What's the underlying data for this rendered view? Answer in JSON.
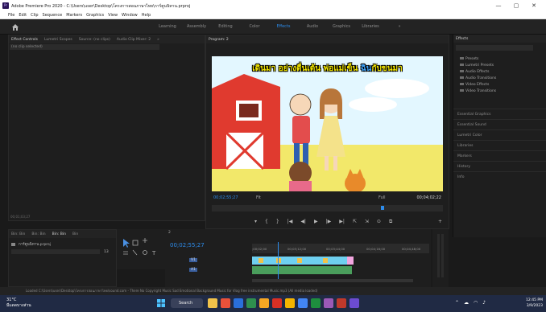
{
  "window": {
    "title": "Adobe Premiere Pro 2020 - C:\\Users\\user\\Desktop\\โครงการสอนภาษาไทย\\การ์ตูนนิทาน.prproj",
    "app_badge": "Pr",
    "controls": [
      "—",
      "▢",
      "✕"
    ]
  },
  "menu": [
    "File",
    "Edit",
    "Clip",
    "Sequence",
    "Markers",
    "Graphics",
    "View",
    "Window",
    "Help"
  ],
  "workspaces": {
    "items": [
      "Learning",
      "Assembly",
      "Editing",
      "Color",
      "Effects",
      "Audio",
      "Graphics",
      "Libraries",
      "»"
    ],
    "active_index": 4
  },
  "left_panel": {
    "tabs": [
      "Effect Controls",
      "Lumetri Scopes",
      "Source: (no clips)",
      "Audio Clip Mixer: 2",
      "»"
    ],
    "clip_selector": "(no clip selected)",
    "timecode": "00;01;03;27"
  },
  "program": {
    "title": "Program: 2",
    "subtitle_main": "เดินมา อย่างตื่นเต้น พ่อแม่เข็น ",
    "subtitle_highlight": "ฉิน",
    "subtitle_tail": "กับขนมา",
    "timecode": "00;02;55;27",
    "fit": "Fit",
    "quality": "Full",
    "duration": "00;04;02;22",
    "transport": [
      "▾",
      "{",
      "}",
      "|◀",
      "◀|",
      "▶",
      "|▶",
      "▶|",
      "⇱",
      "⇲",
      "⊙",
      "⧉"
    ],
    "add": "+"
  },
  "effects": {
    "title": "Effects",
    "tree": [
      "Presets",
      "Lumetri Presets",
      "Audio Effects",
      "Audio Transitions",
      "Video Effects",
      "Video Transitions"
    ],
    "sections": [
      "Essential Graphics",
      "Essential Sound",
      "Lumetri Color",
      "Libraries",
      "Markers",
      "History",
      "Info"
    ]
  },
  "project": {
    "tabs": [
      "Bin: Bin",
      "Bin: Bin",
      "Bin: Bin",
      "Bin"
    ],
    "file": "การ์ตูนนิทาน.prproj",
    "count": "13"
  },
  "timeline": {
    "tab": "2",
    "timecode": "00;02;55;27",
    "ruler": [
      ";00;02;00",
      "00;03;12;00",
      "00;03;44;00",
      "00;04;16;00",
      "00;04;48;00"
    ],
    "tracks": [
      "V1",
      "A1"
    ]
  },
  "status": "Loaded C:\\Users\\user\\Desktop\\โครงการสอนภาษาไทย\\sound.com - There No Copyright Music Sad Emotional Background Music for Vlog free instrumental Music.mp3 (All media loaded)",
  "taskbar": {
    "temp": "31°C",
    "weather": "มีแดดบางส่วน",
    "search": "Search",
    "time": "12:45 PM",
    "date": "3/9/2023",
    "app_colors": [
      "#f0c24a",
      "#e8513a",
      "#2a6fdb",
      "#2f8f4e",
      "#f5a623",
      "#d93025",
      "#f4b400",
      "#4285f4",
      "#1e8e3e",
      "#9b59b6",
      "#c0392b",
      "#6c4cd1"
    ]
  },
  "colors": {
    "accent": "#2d8ceb",
    "panel": "#1e1e1e",
    "subtitle": "#f3e600"
  }
}
